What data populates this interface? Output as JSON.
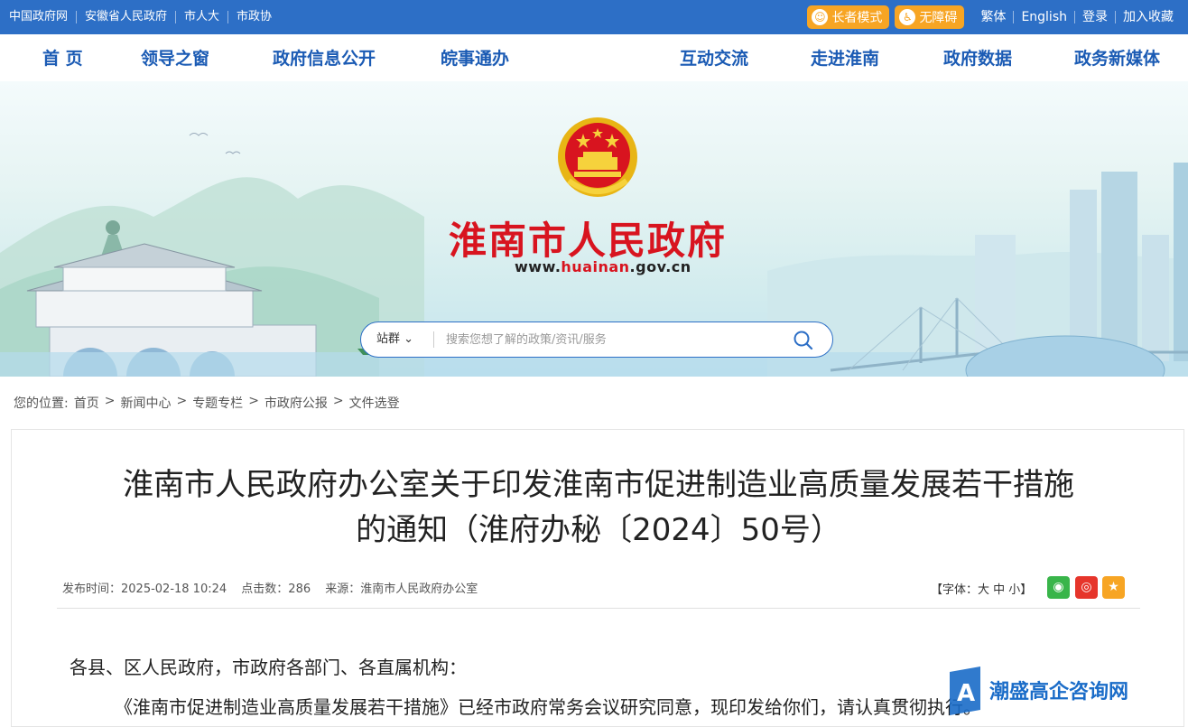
{
  "topbar": {
    "left_links": [
      "中国政府网",
      "安徽省人民政府",
      "市人大",
      "市政协"
    ],
    "elder_mode": "长者模式",
    "accessibility": "无障碍",
    "right_links": [
      "繁体",
      "English",
      "登录",
      "加入收藏"
    ]
  },
  "nav": {
    "items": [
      "首 页",
      "领导之窗",
      "政府信息公开",
      "皖事通办",
      "互动交流",
      "走进淮南",
      "政府数据",
      "政务新媒体"
    ]
  },
  "banner": {
    "site_title": "淮南市人民政府",
    "url_prefix": "www.",
    "url_domain": "huainan",
    "url_suffix": ".gov.cn"
  },
  "search": {
    "scope": "站群",
    "placeholder": "搜索您想了解的政策/资讯/服务"
  },
  "breadcrumb": {
    "label": "您的位置:",
    "items": [
      "首页",
      "新闻中心",
      "专题专栏",
      "市政府公报",
      "文件选登"
    ]
  },
  "article": {
    "title_line1": "淮南市人民政府办公室关于印发淮南市促进制造业高质量发展若干措施",
    "title_line2": "的通知（淮府办秘〔2024〕50号）",
    "publish_time": "发布时间：2025-02-18 10:24",
    "clicks": "点击数：286",
    "source": "来源：淮南市人民政府办公室",
    "font_size_label": "【字体：大 中 小】",
    "paragraph1": "各县、区人民政府，市政府各部门、各直属机构：",
    "paragraph2": "《淮南市促进制造业高质量发展若干措施》已经市政府常务会议研究同意，现印发给你们，请认真贯彻执行。"
  },
  "watermark": {
    "text": "潮盛高企咨询网"
  },
  "colors": {
    "topbar": "#2d6fc6",
    "nav_text": "#1b5bb4",
    "title_red": "#d8141f",
    "pill_orange": "#f7a524",
    "wechat": "#39b54a",
    "weibo": "#e6352b",
    "favorite": "#f7a524"
  }
}
